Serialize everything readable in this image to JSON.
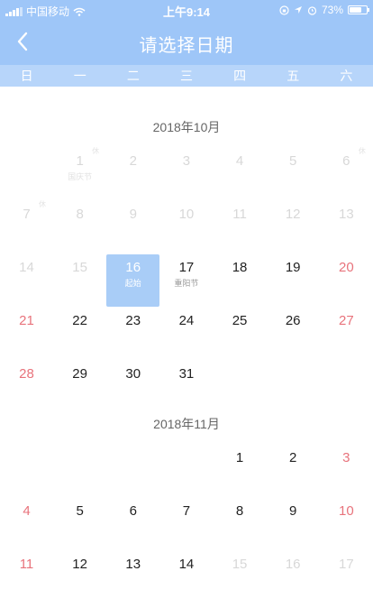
{
  "status_bar": {
    "carrier": "中国移动",
    "time": "上午9:14",
    "battery_percent": "73%",
    "battery_level": 0.73
  },
  "nav": {
    "title": "请选择日期",
    "back_icon": "chevron-left-icon"
  },
  "weekdays": [
    "日",
    "一",
    "二",
    "三",
    "四",
    "五",
    "六"
  ],
  "months": [
    {
      "title": "2018年10月",
      "first_weekday": 1,
      "days": 31,
      "past_until": 15,
      "selected": 16,
      "selected_label": "起始",
      "day_labels": {
        "1": "国庆节",
        "17": "重阳节"
      },
      "badges": {
        "1": "休",
        "6": "休",
        "7": "休"
      }
    },
    {
      "title": "2018年11月",
      "first_weekday": 4,
      "days": 17,
      "past_until": 0,
      "faded_from": 15,
      "selected": null,
      "selected_label": "",
      "day_labels": {},
      "badges": {}
    }
  ],
  "colors": {
    "header": "#9ec6f8",
    "weekday_bar": "#b7d5fa",
    "selected": "#a9cdf7",
    "weekend": "#e8737c"
  }
}
